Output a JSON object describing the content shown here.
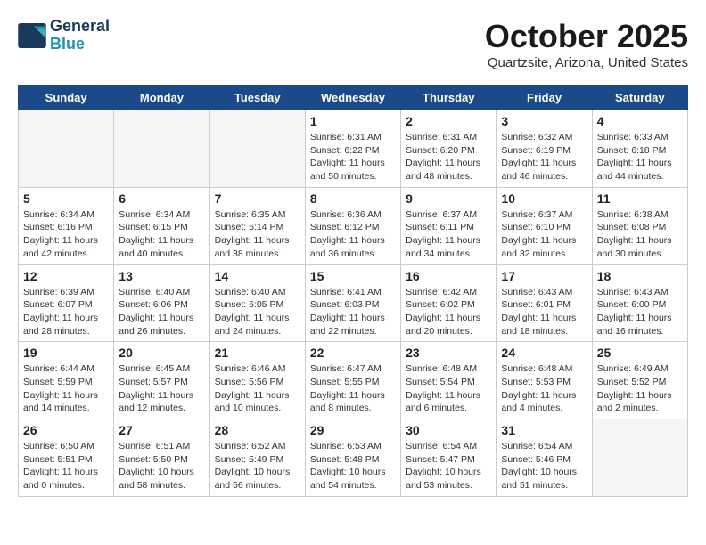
{
  "header": {
    "logo_line1": "General",
    "logo_line2": "Blue",
    "month": "October 2025",
    "location": "Quartzsite, Arizona, United States"
  },
  "weekdays": [
    "Sunday",
    "Monday",
    "Tuesday",
    "Wednesday",
    "Thursday",
    "Friday",
    "Saturday"
  ],
  "weeks": [
    [
      {
        "day": "",
        "info": ""
      },
      {
        "day": "",
        "info": ""
      },
      {
        "day": "",
        "info": ""
      },
      {
        "day": "1",
        "info": "Sunrise: 6:31 AM\nSunset: 6:22 PM\nDaylight: 11 hours\nand 50 minutes."
      },
      {
        "day": "2",
        "info": "Sunrise: 6:31 AM\nSunset: 6:20 PM\nDaylight: 11 hours\nand 48 minutes."
      },
      {
        "day": "3",
        "info": "Sunrise: 6:32 AM\nSunset: 6:19 PM\nDaylight: 11 hours\nand 46 minutes."
      },
      {
        "day": "4",
        "info": "Sunrise: 6:33 AM\nSunset: 6:18 PM\nDaylight: 11 hours\nand 44 minutes."
      }
    ],
    [
      {
        "day": "5",
        "info": "Sunrise: 6:34 AM\nSunset: 6:16 PM\nDaylight: 11 hours\nand 42 minutes."
      },
      {
        "day": "6",
        "info": "Sunrise: 6:34 AM\nSunset: 6:15 PM\nDaylight: 11 hours\nand 40 minutes."
      },
      {
        "day": "7",
        "info": "Sunrise: 6:35 AM\nSunset: 6:14 PM\nDaylight: 11 hours\nand 38 minutes."
      },
      {
        "day": "8",
        "info": "Sunrise: 6:36 AM\nSunset: 6:12 PM\nDaylight: 11 hours\nand 36 minutes."
      },
      {
        "day": "9",
        "info": "Sunrise: 6:37 AM\nSunset: 6:11 PM\nDaylight: 11 hours\nand 34 minutes."
      },
      {
        "day": "10",
        "info": "Sunrise: 6:37 AM\nSunset: 6:10 PM\nDaylight: 11 hours\nand 32 minutes."
      },
      {
        "day": "11",
        "info": "Sunrise: 6:38 AM\nSunset: 6:08 PM\nDaylight: 11 hours\nand 30 minutes."
      }
    ],
    [
      {
        "day": "12",
        "info": "Sunrise: 6:39 AM\nSunset: 6:07 PM\nDaylight: 11 hours\nand 28 minutes."
      },
      {
        "day": "13",
        "info": "Sunrise: 6:40 AM\nSunset: 6:06 PM\nDaylight: 11 hours\nand 26 minutes."
      },
      {
        "day": "14",
        "info": "Sunrise: 6:40 AM\nSunset: 6:05 PM\nDaylight: 11 hours\nand 24 minutes."
      },
      {
        "day": "15",
        "info": "Sunrise: 6:41 AM\nSunset: 6:03 PM\nDaylight: 11 hours\nand 22 minutes."
      },
      {
        "day": "16",
        "info": "Sunrise: 6:42 AM\nSunset: 6:02 PM\nDaylight: 11 hours\nand 20 minutes."
      },
      {
        "day": "17",
        "info": "Sunrise: 6:43 AM\nSunset: 6:01 PM\nDaylight: 11 hours\nand 18 minutes."
      },
      {
        "day": "18",
        "info": "Sunrise: 6:43 AM\nSunset: 6:00 PM\nDaylight: 11 hours\nand 16 minutes."
      }
    ],
    [
      {
        "day": "19",
        "info": "Sunrise: 6:44 AM\nSunset: 5:59 PM\nDaylight: 11 hours\nand 14 minutes."
      },
      {
        "day": "20",
        "info": "Sunrise: 6:45 AM\nSunset: 5:57 PM\nDaylight: 11 hours\nand 12 minutes."
      },
      {
        "day": "21",
        "info": "Sunrise: 6:46 AM\nSunset: 5:56 PM\nDaylight: 11 hours\nand 10 minutes."
      },
      {
        "day": "22",
        "info": "Sunrise: 6:47 AM\nSunset: 5:55 PM\nDaylight: 11 hours\nand 8 minutes."
      },
      {
        "day": "23",
        "info": "Sunrise: 6:48 AM\nSunset: 5:54 PM\nDaylight: 11 hours\nand 6 minutes."
      },
      {
        "day": "24",
        "info": "Sunrise: 6:48 AM\nSunset: 5:53 PM\nDaylight: 11 hours\nand 4 minutes."
      },
      {
        "day": "25",
        "info": "Sunrise: 6:49 AM\nSunset: 5:52 PM\nDaylight: 11 hours\nand 2 minutes."
      }
    ],
    [
      {
        "day": "26",
        "info": "Sunrise: 6:50 AM\nSunset: 5:51 PM\nDaylight: 11 hours\nand 0 minutes."
      },
      {
        "day": "27",
        "info": "Sunrise: 6:51 AM\nSunset: 5:50 PM\nDaylight: 10 hours\nand 58 minutes."
      },
      {
        "day": "28",
        "info": "Sunrise: 6:52 AM\nSunset: 5:49 PM\nDaylight: 10 hours\nand 56 minutes."
      },
      {
        "day": "29",
        "info": "Sunrise: 6:53 AM\nSunset: 5:48 PM\nDaylight: 10 hours\nand 54 minutes."
      },
      {
        "day": "30",
        "info": "Sunrise: 6:54 AM\nSunset: 5:47 PM\nDaylight: 10 hours\nand 53 minutes."
      },
      {
        "day": "31",
        "info": "Sunrise: 6:54 AM\nSunset: 5:46 PM\nDaylight: 10 hours\nand 51 minutes."
      },
      {
        "day": "",
        "info": ""
      }
    ]
  ]
}
